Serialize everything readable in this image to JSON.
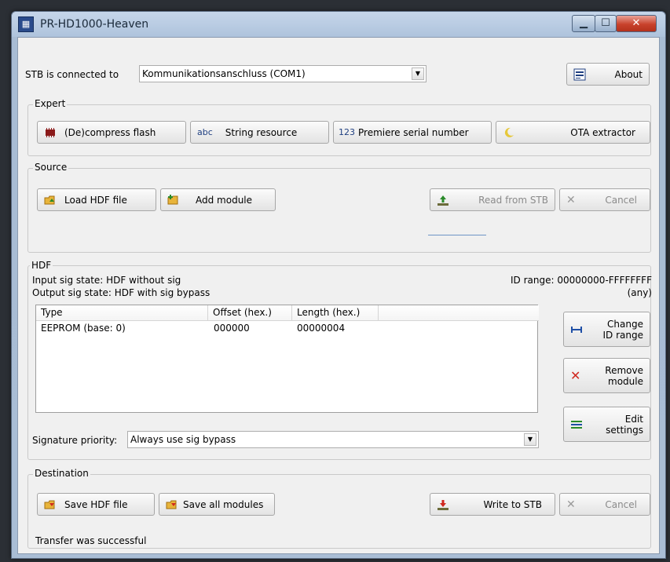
{
  "window": {
    "title": "PR-HD1000-Heaven"
  },
  "connection": {
    "label": "STB is connected to",
    "port": "Kommunikationsanschluss (COM1)",
    "about_label": "About"
  },
  "expert": {
    "title": "Expert",
    "decompress": "(De)compress flash",
    "string_resource_icon_text": "abc",
    "string_resource": "String resource",
    "premiere_icon_text": "123",
    "premiere": "Premiere serial number",
    "ota": "OTA extractor"
  },
  "source": {
    "title": "Source",
    "load": "Load HDF file",
    "add_module": "Add module",
    "read_from_stb": "Read from STB",
    "cancel": "Cancel"
  },
  "hdf": {
    "title": "HDF",
    "input_sig": "Input sig state: HDF without sig",
    "output_sig": "Output sig state: HDF with sig bypass",
    "id_range": "ID range: 00000000-FFFFFFFF",
    "id_any": "(any)",
    "columns": [
      "Type",
      "Offset (hex.)",
      "Length (hex.)"
    ],
    "rows": [
      {
        "type": "EEPROM (base: 0)",
        "offset": "000000",
        "length": "00000004"
      }
    ],
    "change_id_1": "Change",
    "change_id_2": "ID range",
    "remove_1": "Remove",
    "remove_2": "module",
    "edit_1": "Edit",
    "edit_2": "settings",
    "sig_priority_label": "Signature priority:",
    "sig_priority_value": "Always use sig bypass"
  },
  "destination": {
    "title": "Destination",
    "save_hdf": "Save HDF file",
    "save_all": "Save all modules",
    "write_to_stb": "Write to STB",
    "cancel": "Cancel",
    "status": "Transfer was successful"
  },
  "colors": {
    "accent_red": "#d0281f",
    "accent_blue": "#1f4fa6",
    "accent_green": "#2a8a2a"
  }
}
